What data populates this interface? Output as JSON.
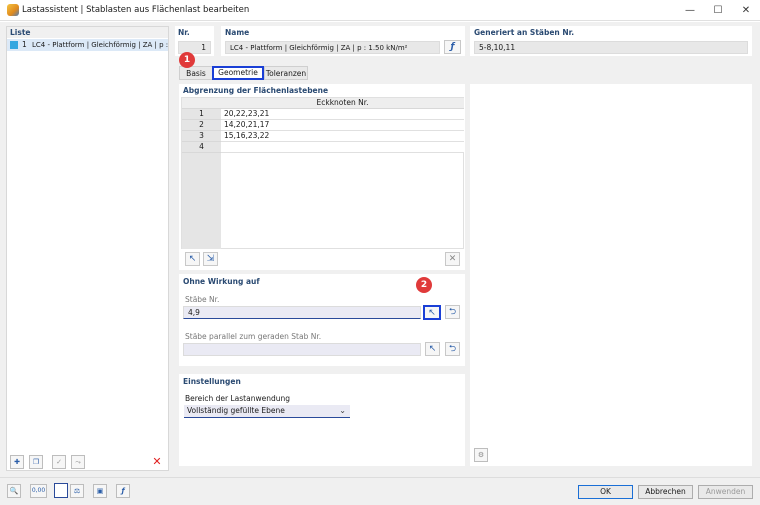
{
  "window": {
    "title": "Lastassistent | Stablasten aus Flächenlast bearbeiten",
    "minimize_glyph": "—",
    "maximize_glyph": "☐",
    "close_glyph": "✕"
  },
  "list": {
    "header": "Liste",
    "items": [
      {
        "number": "1",
        "label": "LC4 - Plattform | Gleichförmig | ZA | p :",
        "color": "#35a7e0"
      }
    ]
  },
  "nr": {
    "label": "Nr.",
    "value": "1"
  },
  "name": {
    "label": "Name",
    "value": "LC4 - Plattform | Gleichförmig | ZA | p : 1.50 kN/m²"
  },
  "generated": {
    "label": "Generiert an Stäben Nr.",
    "value": "5-8,10,11"
  },
  "tabs": [
    {
      "label": "Basis"
    },
    {
      "label": "Geometrie"
    },
    {
      "label": "Toleranzen"
    }
  ],
  "boundary": {
    "title": "Abgrenzung der Flächenlastebene",
    "column_header": "Eckknoten Nr.",
    "rows": [
      {
        "num": "1",
        "value": "20,22,23,21"
      },
      {
        "num": "2",
        "value": "14,20,21,17"
      },
      {
        "num": "3",
        "value": "15,16,23,22"
      },
      {
        "num": "4",
        "value": ""
      }
    ]
  },
  "no_effect": {
    "title": "Ohne Wirkung auf",
    "members_label": "Stäbe Nr.",
    "members_value": "4,9",
    "parallel_label": "Stäbe parallel zum geraden Stab Nr.",
    "parallel_value": ""
  },
  "settings": {
    "title": "Einstellungen",
    "range_label": "Bereich der Lastanwendung",
    "range_value": "Vollständig gefüllte Ebene"
  },
  "badges": [
    "1",
    "2"
  ],
  "buttons": {
    "ok": "OK",
    "cancel": "Abbrechen",
    "apply": "Anwenden"
  },
  "bottom_icons": {
    "units_icon_text": "0,00"
  },
  "colors": {
    "accent": "#1a3fd6",
    "header_text": "#2a4a72",
    "badge": "#e03a3a",
    "delete": "#e02020"
  }
}
